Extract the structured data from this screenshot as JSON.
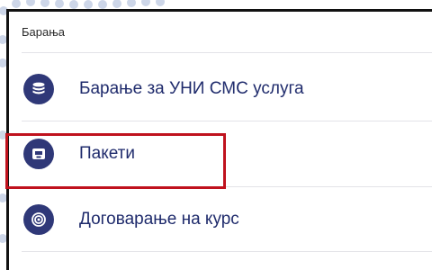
{
  "section": {
    "title": "Барања"
  },
  "items": [
    {
      "label": "Барање за УНИ СМС услуга",
      "icon": "coins-icon"
    },
    {
      "label": "Пакети",
      "icon": "package-icon"
    },
    {
      "label": "Договарање на курс",
      "icon": "exchange-rate-icon"
    }
  ],
  "colors": {
    "icon_bg": "#2f3878",
    "label": "#1f2b6c",
    "highlight": "#c0121d"
  }
}
